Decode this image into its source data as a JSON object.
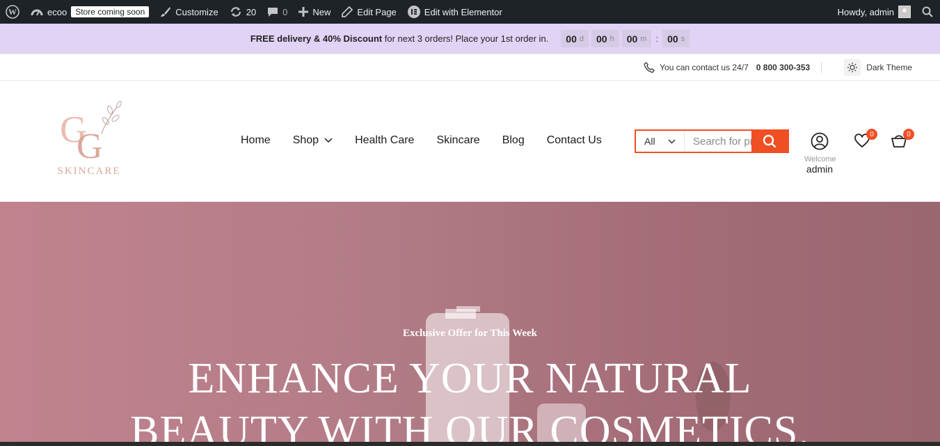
{
  "admin_bar": {
    "site_name": "ecoo",
    "store_badge": "Store coming soon",
    "customize": "Customize",
    "updates_count": "20",
    "comments_count": "0",
    "new": "New",
    "edit_page": "Edit Page",
    "edit_elementor": "Edit with Elementor",
    "howdy": "Howdy, admin"
  },
  "promo": {
    "bold_text": "FREE delivery & 40% Discount",
    "text": " for next 3 orders! Place your 1st order in.",
    "timer": [
      {
        "value": "00",
        "unit": "d"
      },
      {
        "value": "00",
        "unit": "h"
      },
      {
        "value": "00",
        "unit": "m"
      },
      {
        "value": "00",
        "unit": "s"
      }
    ],
    "separator": ":"
  },
  "topinfo": {
    "contact_text": "You can contact us 24/7",
    "phone": "0 800 300-353",
    "theme_label": "Dark Theme"
  },
  "header": {
    "logo_text": "SKINCARE",
    "nav": [
      "Home",
      "Shop",
      "Health Care",
      "Skincare",
      "Blog",
      "Contact Us"
    ],
    "search": {
      "category": "All",
      "placeholder": "Search for products"
    },
    "account": {
      "welcome": "Welcome",
      "username": "admin"
    },
    "wishlist_count": "0",
    "cart_count": "0"
  },
  "hero": {
    "subtitle": "Exclusive Offer for This Week",
    "title_line1": "ENHANCE YOUR NATURAL",
    "title_line2": "BEAUTY WITH OUR COSMETICS."
  },
  "colors": {
    "admin_bar_bg": "#1d2327",
    "promo_bg": "#e1d3f5",
    "accent": "#f04e23",
    "hero_bg": "#b27c87",
    "logo": "#d9a89a"
  }
}
